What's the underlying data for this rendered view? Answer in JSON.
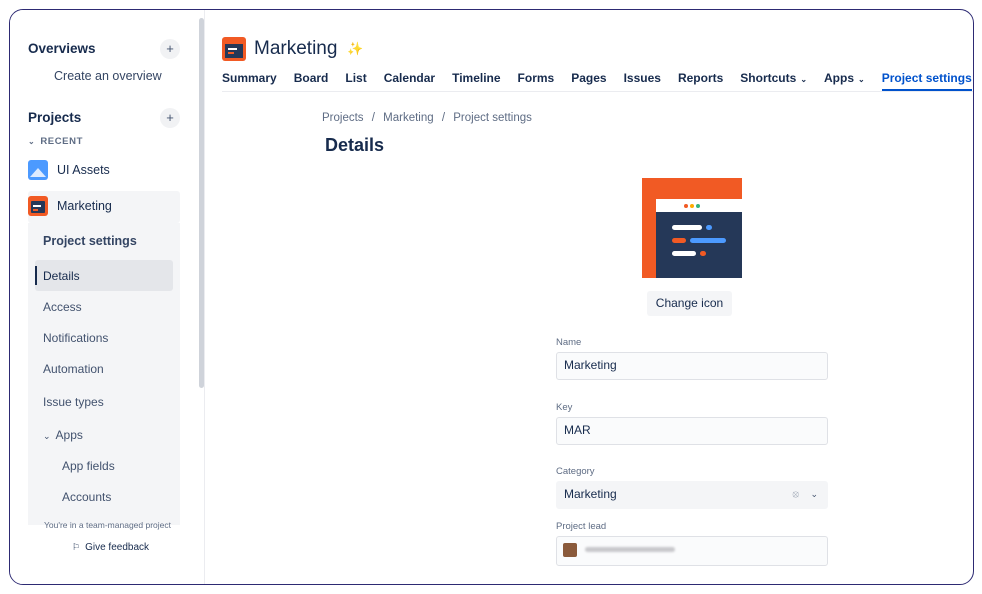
{
  "sidebar": {
    "overviews_title": "Overviews",
    "create_overview": "Create an overview",
    "projects_title": "Projects",
    "recent_label": "RECENT",
    "projects": [
      {
        "name": "UI Assets"
      },
      {
        "name": "Marketing"
      }
    ],
    "project_settings": "Project settings",
    "nav": [
      {
        "label": "Details"
      },
      {
        "label": "Access"
      },
      {
        "label": "Notifications"
      },
      {
        "label": "Automation"
      },
      {
        "label": "Issue types"
      },
      {
        "label": "Apps"
      },
      {
        "label": "App fields"
      },
      {
        "label": "Accounts"
      }
    ],
    "team_managed_note": "You're in a team-managed project",
    "give_feedback": "Give feedback"
  },
  "header": {
    "project_name": "Marketing",
    "tabs": [
      {
        "label": "Summary"
      },
      {
        "label": "Board"
      },
      {
        "label": "List"
      },
      {
        "label": "Calendar"
      },
      {
        "label": "Timeline"
      },
      {
        "label": "Forms"
      },
      {
        "label": "Pages"
      },
      {
        "label": "Issues"
      },
      {
        "label": "Reports"
      },
      {
        "label": "Shortcuts"
      },
      {
        "label": "Apps"
      },
      {
        "label": "Project settings"
      }
    ]
  },
  "breadcrumb": [
    "Projects",
    "/",
    "Marketing",
    "/",
    "Project settings"
  ],
  "page_title": "Details",
  "form": {
    "change_icon": "Change icon",
    "name_label": "Name",
    "name_value": "Marketing",
    "key_label": "Key",
    "key_value": "MAR",
    "category_label": "Category",
    "category_value": "Marketing",
    "lead_label": "Project lead"
  },
  "colors": {
    "brand_orange": "#f15a24",
    "navy": "#253858",
    "accent_blue": "#0052cc"
  }
}
